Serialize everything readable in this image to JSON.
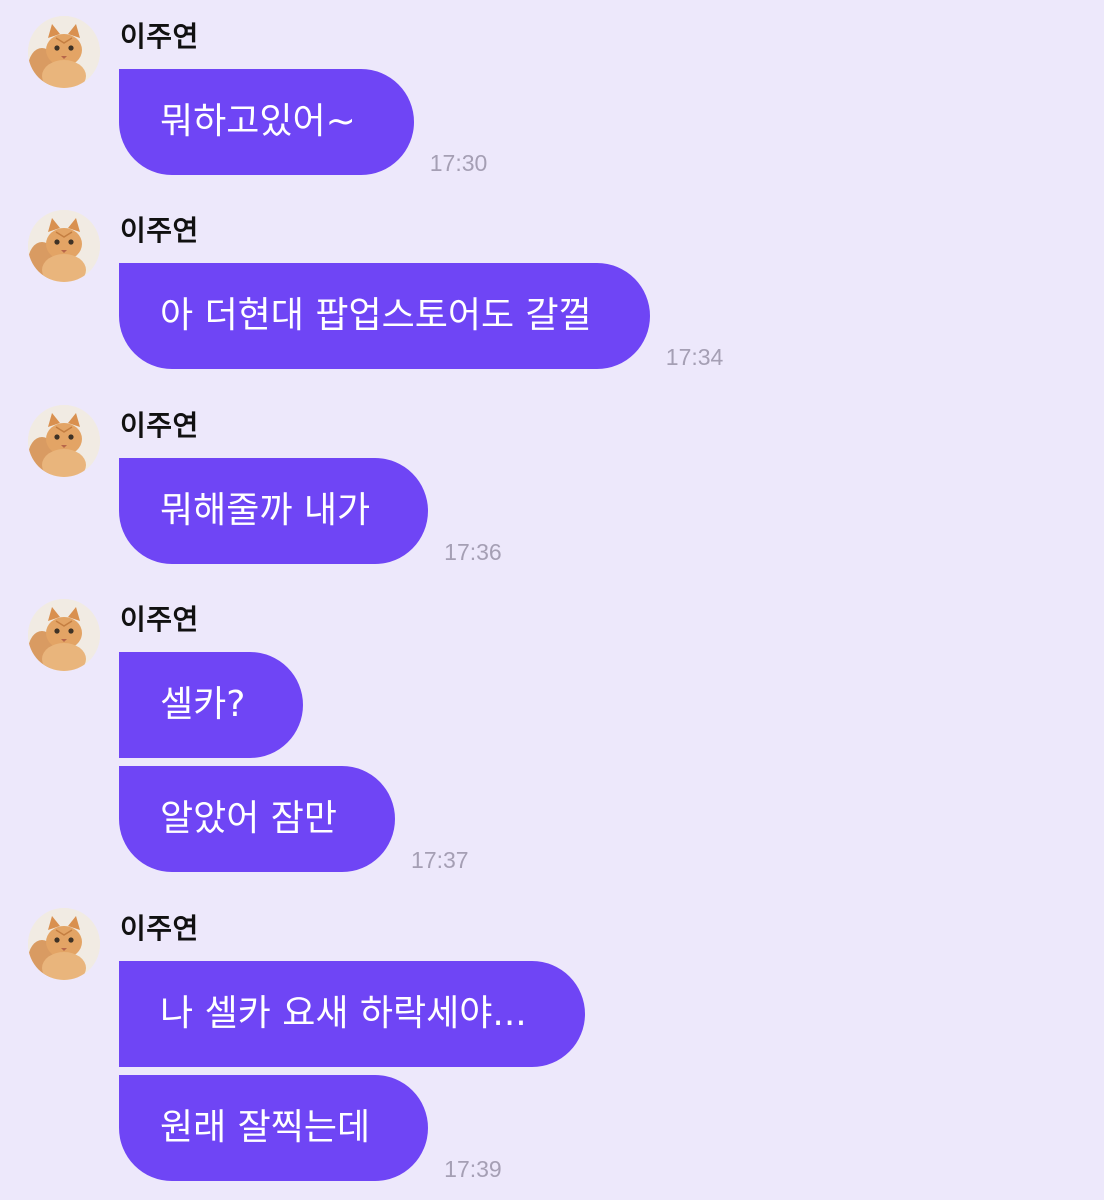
{
  "colors": {
    "background": "#ede8fb",
    "bubble": "#6f45f5",
    "bubble_text": "#ffffff",
    "name_text": "#111111",
    "time_text": "#a59fb4"
  },
  "sender": {
    "name": "이주연",
    "avatar_icon": "orange-cat-avatar-icon"
  },
  "groups": [
    {
      "name": "이주연",
      "messages": [
        {
          "text": "뭐하고있어~",
          "time": "17:30"
        }
      ]
    },
    {
      "name": "이주연",
      "messages": [
        {
          "text": "아 더현대 팝업스토어도 갈껄",
          "time": "17:34"
        }
      ]
    },
    {
      "name": "이주연",
      "messages": [
        {
          "text": "뭐해줄까 내가",
          "time": "17:36"
        }
      ]
    },
    {
      "name": "이주연",
      "messages": [
        {
          "text": "셀카?",
          "time": ""
        },
        {
          "text": "알았어 잠만",
          "time": "17:37"
        }
      ]
    },
    {
      "name": "이주연",
      "messages": [
        {
          "text": "나 셀카 요새 하락세야...",
          "time": ""
        },
        {
          "text": "원래 잘찍는데",
          "time": "17:39"
        }
      ]
    }
  ]
}
